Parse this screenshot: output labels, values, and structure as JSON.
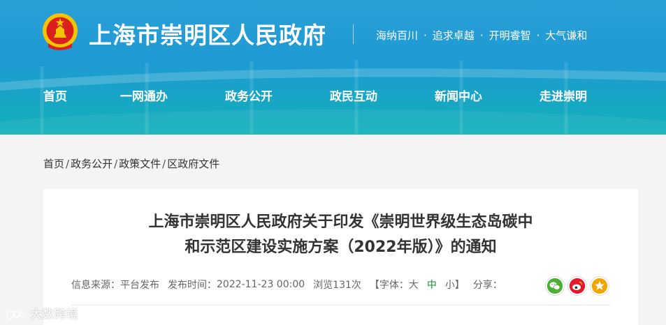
{
  "header": {
    "site_title": "上海市崇明区人民政府",
    "slogans": [
      "海纳百川",
      "追求卓越",
      "开明睿智",
      "大气谦和"
    ],
    "slogan_separator": "·"
  },
  "nav": [
    {
      "label": "首页"
    },
    {
      "label": "一网通办"
    },
    {
      "label": "政务公开"
    },
    {
      "label": "政民互动"
    },
    {
      "label": "新闻中心"
    },
    {
      "label": "走进崇明"
    }
  ],
  "breadcrumb": {
    "separator": "/",
    "items": [
      "首页",
      "政务公开",
      "政策文件",
      "区政府文件"
    ]
  },
  "article": {
    "title_line1": "上海市崇明区人民政府关于印发《崇明世界级生态岛碳中",
    "title_line2": "和示范区建设实施方案（2022年版）》的通知",
    "meta": {
      "source_label": "信息来源：",
      "source_value": "平台发布",
      "time_label": "发布时间：",
      "time_value": "2022-11-23 00:00",
      "views": "浏览131次",
      "font_label": "【字体：",
      "font_large": "大",
      "font_medium": "中",
      "font_small": "小",
      "font_close": "】",
      "share_label": "分享："
    },
    "share_icons": [
      "wechat-icon",
      "weibo-icon",
      "favorite-star-icon"
    ]
  },
  "watermark": {
    "text": "大数跨境"
  },
  "colors": {
    "banner": "#1f9ad4",
    "banner_bottom": "#12b2ba",
    "page_bg": "#f4f4f4",
    "font_medium": "#1a8f2e",
    "wechat": "#4cb035",
    "weibo": "#e6162d",
    "favorite": "#f2a400"
  }
}
